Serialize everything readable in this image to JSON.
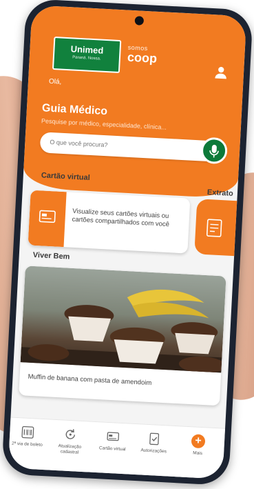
{
  "header": {
    "unimed_logo": "Unimed",
    "unimed_tagline": "Paraná. Nossa.",
    "coop_logo_small": "somos",
    "coop_logo_big": "coop",
    "greeting": "Olá,",
    "guia_title": "Guia Médico",
    "guia_subtitle": "Pesquise por médico, especialidade, clínica...",
    "search_placeholder": "O que você procura?"
  },
  "sections": {
    "cartao_virtual": "Cartão virtual",
    "extrato": "Extrato",
    "cartao_card_text": "Visualize seus cartões virtuais ou cartões compartilhados com você",
    "viver_bem": "Viver Bem",
    "viver_bem_caption": "Muffin de banana com pasta de amendoim"
  },
  "bottom_nav": [
    {
      "label": "2ª via de boleto",
      "icon": "barcode-icon"
    },
    {
      "label": "Atualização cadastral",
      "icon": "update-icon"
    },
    {
      "label": "Cartão virtual",
      "icon": "card-icon"
    },
    {
      "label": "Autorizações",
      "icon": "document-check-icon"
    },
    {
      "label": "Mais",
      "icon": "plus-icon"
    }
  ],
  "colors": {
    "brand_orange": "#f27b21",
    "unimed_green": "#11813d",
    "mic_green": "#0d7a3a"
  }
}
